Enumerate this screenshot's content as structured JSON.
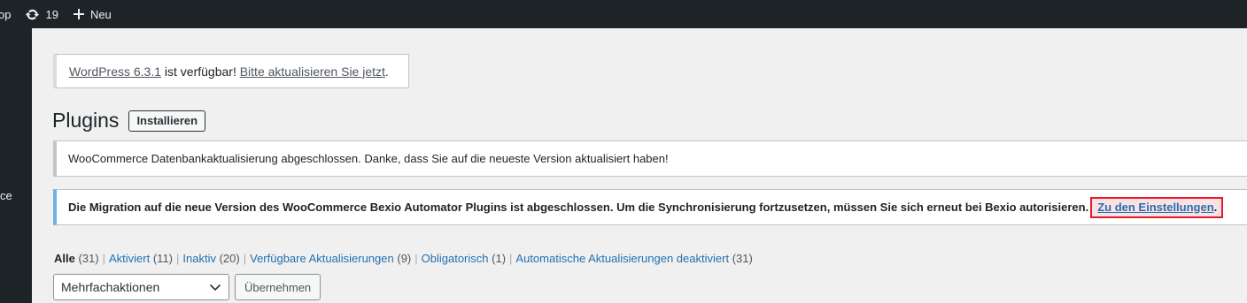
{
  "admin_bar": {
    "site_name_fragment": "op",
    "updates_count": "19",
    "new_label": "Neu"
  },
  "sidebar": {
    "menu_fragment": "ce"
  },
  "update_notice": {
    "version_link": "WordPress 6.3.1",
    "text": " ist verfügbar! ",
    "action_link": "Bitte aktualisieren Sie jetzt",
    "end": "."
  },
  "page": {
    "title": "Plugins",
    "install_button": "Installieren"
  },
  "notices": {
    "db_update": "WooCommerce Datenbankaktualisierung abgeschlossen. Danke, dass Sie auf die neueste Version aktualisiert haben!",
    "migration_text": "Die Migration auf die neue Version des WooCommerce Bexio Automator Plugins ist abgeschlossen. Um die Synchronisierung fortzusetzen, müssen Sie sich erneut bei Bexio autorisieren.",
    "settings_link": "Zu den Einstellungen",
    "settings_end": "."
  },
  "filters": [
    {
      "label": "Alle",
      "count": "(31)"
    },
    {
      "label": "Aktiviert",
      "count": "(11)"
    },
    {
      "label": "Inaktiv",
      "count": "(20)"
    },
    {
      "label": "Verfügbare Aktualisierungen",
      "count": "(9)"
    },
    {
      "label": "Obligatorisch",
      "count": "(1)"
    },
    {
      "label": "Automatische Aktualisierungen deaktiviert",
      "count": "(31)"
    }
  ],
  "filter_separator": "|",
  "bulk_actions": {
    "selected": "Mehrfachaktionen",
    "apply_button": "Übernehmen"
  },
  "colors": {
    "admin_bar_bg": "#1d2327",
    "info_border": "#72aee6",
    "highlight_border": "#e11b2b",
    "link": "#2271b1"
  }
}
